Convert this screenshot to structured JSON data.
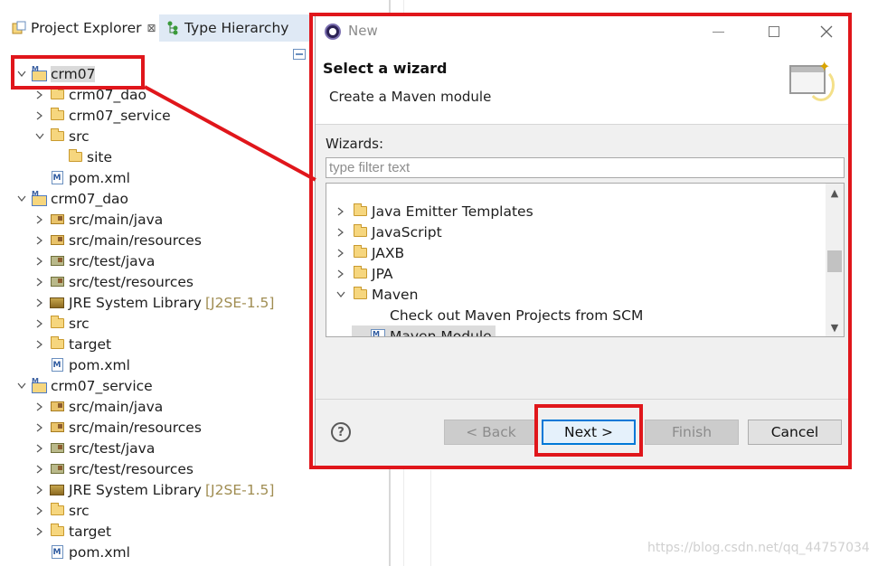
{
  "explorer": {
    "tabs": [
      {
        "label": "Project Explorer",
        "close": "⊠"
      },
      {
        "label": "Type Hierarchy"
      }
    ],
    "rows": [
      {
        "label": "crm07",
        "twisty": "v",
        "icon": "project",
        "level": 0,
        "selected": true
      },
      {
        "label": "crm07_dao",
        "twisty": ">",
        "icon": "folder",
        "level": 1
      },
      {
        "label": "crm07_service",
        "twisty": ">",
        "icon": "folder",
        "level": 1
      },
      {
        "label": "src",
        "twisty": "v",
        "icon": "folder",
        "level": 1
      },
      {
        "label": "site",
        "twisty": "",
        "icon": "folder",
        "level": 2
      },
      {
        "label": "pom.xml",
        "twisty": "",
        "icon": "pom",
        "level": 1
      },
      {
        "label": "crm07_dao",
        "twisty": "v",
        "icon": "project",
        "level": 0
      },
      {
        "label": "src/main/java",
        "twisty": ">",
        "icon": "package-folder",
        "level": 1
      },
      {
        "label": "src/main/resources",
        "twisty": ">",
        "icon": "package-folder",
        "level": 1
      },
      {
        "label": "src/test/java",
        "twisty": ">",
        "icon": "test-folder",
        "level": 1
      },
      {
        "label": "src/test/resources",
        "twisty": ">",
        "icon": "test-folder",
        "level": 1
      },
      {
        "label": "JRE System Library",
        "decoration": "[J2SE-1.5]",
        "twisty": ">",
        "icon": "library",
        "level": 1
      },
      {
        "label": "src",
        "twisty": ">",
        "icon": "folder",
        "level": 1
      },
      {
        "label": "target",
        "twisty": ">",
        "icon": "folder",
        "level": 1
      },
      {
        "label": "pom.xml",
        "twisty": "",
        "icon": "pom",
        "level": 1
      },
      {
        "label": "crm07_service",
        "twisty": "v",
        "icon": "project",
        "level": 0
      },
      {
        "label": "src/main/java",
        "twisty": ">",
        "icon": "package-folder",
        "level": 1
      },
      {
        "label": "src/main/resources",
        "twisty": ">",
        "icon": "package-folder",
        "level": 1
      },
      {
        "label": "src/test/java",
        "twisty": ">",
        "icon": "test-folder",
        "level": 1
      },
      {
        "label": "src/test/resources",
        "twisty": ">",
        "icon": "test-folder",
        "level": 1
      },
      {
        "label": "JRE System Library",
        "decoration": "[J2SE-1.5]",
        "twisty": ">",
        "icon": "library",
        "level": 1
      },
      {
        "label": "src",
        "twisty": ">",
        "icon": "folder",
        "level": 1
      },
      {
        "label": "target",
        "twisty": ">",
        "icon": "folder",
        "level": 1
      },
      {
        "label": "pom.xml",
        "twisty": "",
        "icon": "pom",
        "level": 1
      }
    ]
  },
  "dialog": {
    "title": "New",
    "banner_title": "Select a wizard",
    "banner_subtitle": "Create a Maven module",
    "wizards_label": "Wizards:",
    "filter_placeholder": "type filter text",
    "wizards": [
      {
        "label": "Java Emitter Templates",
        "twisty": ">",
        "icon": "folder",
        "level": 0
      },
      {
        "label": "JavaScript",
        "twisty": ">",
        "icon": "folder",
        "level": 0
      },
      {
        "label": "JAXB",
        "twisty": ">",
        "icon": "folder",
        "level": 0
      },
      {
        "label": "JPA",
        "twisty": ">",
        "icon": "folder",
        "level": 0
      },
      {
        "label": "Maven",
        "twisty": "v",
        "icon": "folder",
        "level": 0
      },
      {
        "label": "Check out Maven Projects from SCM",
        "twisty": "",
        "icon": "scm",
        "level": 1
      },
      {
        "label": "Maven Module",
        "twisty": "",
        "icon": "maven-module",
        "level": 1,
        "selected": true
      }
    ],
    "buttons": {
      "back": "< Back",
      "next": "Next >",
      "finish": "Finish",
      "cancel": "Cancel"
    }
  },
  "annotation_color": "#e0161b",
  "watermark": "https://blog.csdn.net/qq_44757034"
}
